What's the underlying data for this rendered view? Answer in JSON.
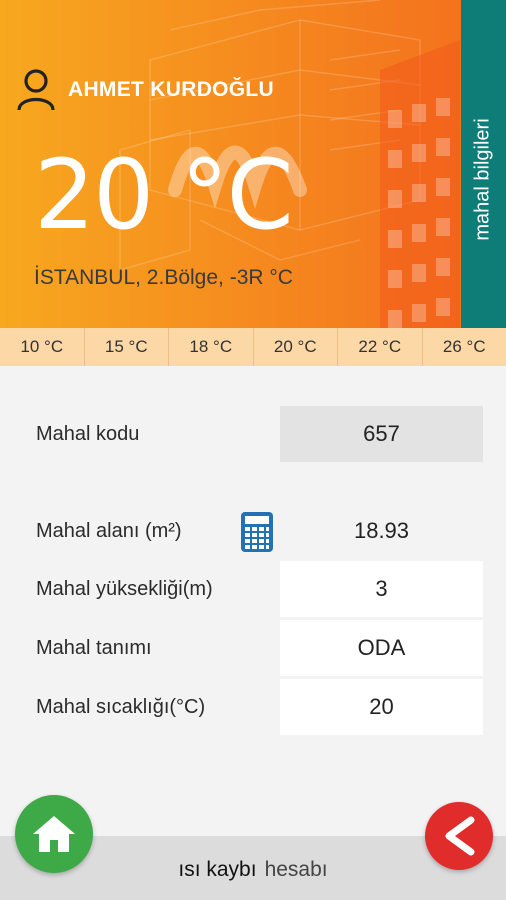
{
  "header": {
    "user_icon": "user-icon",
    "user_name": "AHMET KURDOĞLU",
    "temperature": "20 °C",
    "location": "İSTANBUL, 2.Bölge, -3R °C",
    "side_tab_label": "mahal bilgileri",
    "side_tab_color": "#0f7d77",
    "gradient": [
      "#f7a81f",
      "#f36e1c"
    ]
  },
  "scale": [
    "10 °C",
    "15 °C",
    "18 °C",
    "20 °C",
    "22 °C",
    "26 °C"
  ],
  "form": {
    "code": {
      "label": "Mahal kodu",
      "value": "657"
    },
    "area": {
      "label": "Mahal alanı (m²)",
      "value": "18.93",
      "icon": "calculator-icon"
    },
    "height": {
      "label": "Mahal yüksekliği(m)",
      "value": "3"
    },
    "definition": {
      "label": "Mahal tanımı",
      "value": "ODA"
    },
    "temperature": {
      "label": "Mahal sıcaklığı(°C)",
      "value": "20"
    }
  },
  "footer": {
    "title_part1": "ısı kaybı",
    "title_part2": "hesabı",
    "home_icon": "home-icon",
    "back_icon": "back-arrow-icon",
    "home_color": "#3daa47",
    "back_color": "#e12c2c"
  }
}
